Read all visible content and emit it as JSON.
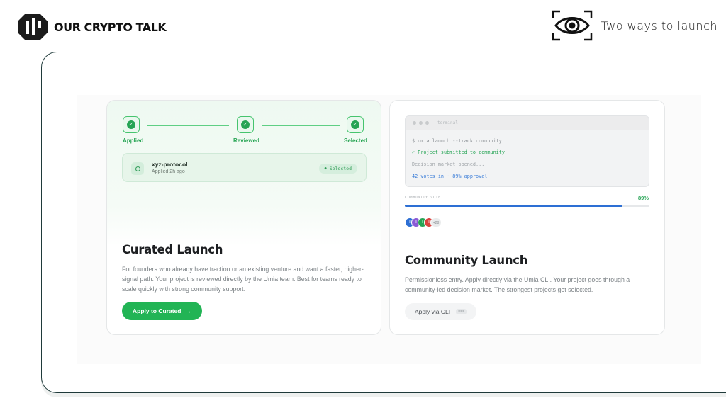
{
  "brand": {
    "name": "OUR CRYPTO TALK"
  },
  "header": {
    "tagline": "Two ways to launch"
  },
  "curated": {
    "steps": [
      "Applied",
      "Reviewed",
      "Selected"
    ],
    "project": {
      "name": "xyz-protocol",
      "time": "Applied 2h ago",
      "badge": "Selected"
    },
    "title": "Curated Launch",
    "description": "For founders who already have traction or an existing venture and want a faster, higher-signal path. Your project is reviewed directly by the Umia team. Best for teams ready to scale quickly with strong community support.",
    "button": "Apply to Curated",
    "button_icon": "→"
  },
  "community": {
    "terminal": {
      "title": "terminal",
      "lines": [
        "$ umia launch --track community",
        "✓ Project submitted to community",
        "Decision market opened...",
        "42 votes in · 89% approval"
      ]
    },
    "vote_label": "COMMUNITY VOTE",
    "vote_percent": "89%",
    "vote_fraction": 0.89,
    "avatar_more": "+28",
    "avatar_colors": [
      "#2d6fd4",
      "#8a5ad6",
      "#26a455",
      "#d9433f"
    ],
    "title": "Community Launch",
    "description": "Permissionless entry. Apply directly via the Umia CLI. Your project goes through a community-led decision market. The strongest projects get selected.",
    "button": "Apply via CLI",
    "button_kbd": "⌘⌘⌘"
  },
  "colors": {
    "accent_green": "#22b455",
    "accent_blue": "#2d6fd4",
    "frame_border": "#1f3a3a"
  }
}
